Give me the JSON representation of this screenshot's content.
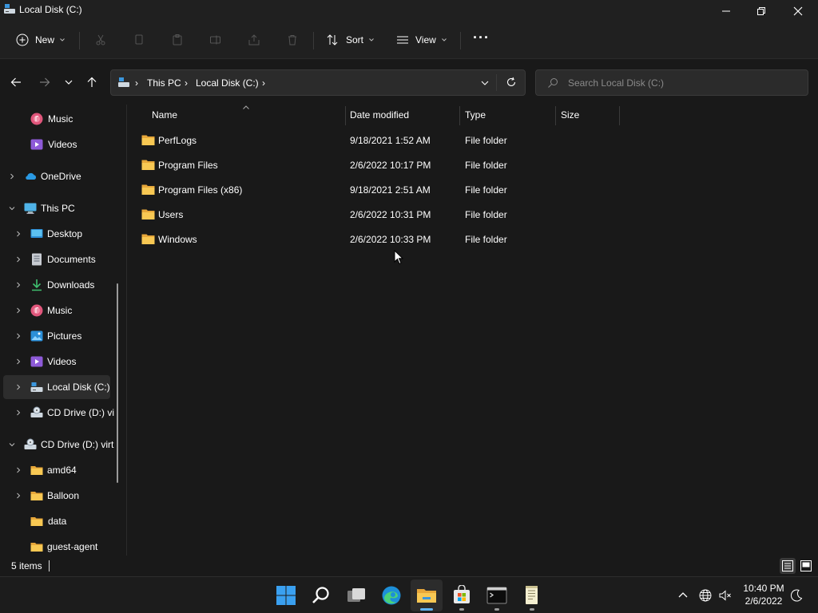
{
  "window": {
    "title": "Local Disk (C:)"
  },
  "toolbar": {
    "new_label": "New",
    "sort_label": "Sort",
    "view_label": "View",
    "more_label": "···"
  },
  "address": {
    "crumbs": [
      "This PC",
      "Local Disk (C:)"
    ]
  },
  "search": {
    "placeholder": "Search Local Disk (C:)"
  },
  "sidebar": {
    "items": [
      {
        "label": "Music",
        "icon": "music-icon"
      },
      {
        "label": "Videos",
        "icon": "videos-icon"
      },
      {
        "label": "OneDrive",
        "icon": "onedrive-icon"
      },
      {
        "label": "This PC",
        "icon": "this-pc-icon"
      },
      {
        "label": "Desktop",
        "icon": "desktop-icon"
      },
      {
        "label": "Documents",
        "icon": "documents-icon"
      },
      {
        "label": "Downloads",
        "icon": "downloads-icon"
      },
      {
        "label": "Music",
        "icon": "music-icon"
      },
      {
        "label": "Pictures",
        "icon": "pictures-icon"
      },
      {
        "label": "Videos",
        "icon": "videos-icon"
      },
      {
        "label": "Local Disk (C:)",
        "icon": "drive-icon"
      },
      {
        "label": "CD Drive (D:) vi",
        "icon": "cd-drive-icon"
      },
      {
        "label": "CD Drive (D:) virt",
        "icon": "cd-drive-icon"
      },
      {
        "label": "amd64",
        "icon": "folder-icon"
      },
      {
        "label": "Balloon",
        "icon": "folder-icon"
      },
      {
        "label": "data",
        "icon": "folder-icon"
      },
      {
        "label": "guest-agent",
        "icon": "folder-icon"
      }
    ]
  },
  "columns": {
    "name": "Name",
    "date": "Date modified",
    "type": "Type",
    "size": "Size"
  },
  "files": [
    {
      "name": "PerfLogs",
      "date": "9/18/2021 1:52 AM",
      "type": "File folder"
    },
    {
      "name": "Program Files",
      "date": "2/6/2022 10:17 PM",
      "type": "File folder"
    },
    {
      "name": "Program Files (x86)",
      "date": "9/18/2021 2:51 AM",
      "type": "File folder"
    },
    {
      "name": "Users",
      "date": "2/6/2022 10:31 PM",
      "type": "File folder"
    },
    {
      "name": "Windows",
      "date": "2/6/2022 10:33 PM",
      "type": "File folder"
    }
  ],
  "status": {
    "items_count": "5 items"
  },
  "taskbar": {
    "apps": [
      "start-icon",
      "search-icon",
      "task-view-icon",
      "edge-icon",
      "file-explorer-icon",
      "store-icon",
      "terminal-icon",
      "notepad-icon"
    ],
    "time": "10:40 PM",
    "date": "2/6/2022"
  },
  "colors": {
    "folder": "#f8c853",
    "accent": "#5fb3f5",
    "background": "#191919"
  }
}
